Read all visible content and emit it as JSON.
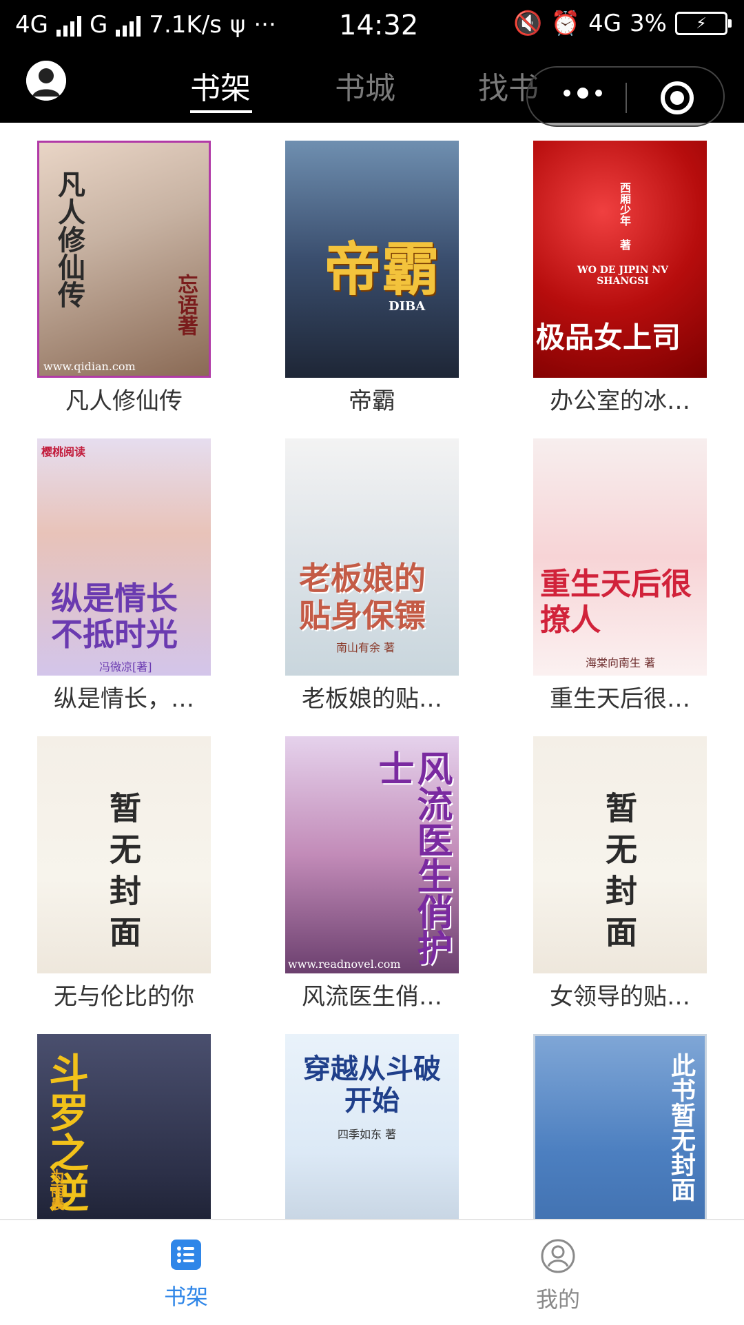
{
  "status_bar": {
    "network1": "4G",
    "network2": "G",
    "speed": "7.1K/s",
    "more": "···",
    "time": "14:32",
    "network3": "4G",
    "battery": "3%"
  },
  "header": {
    "tabs": [
      "书架",
      "书城",
      "找书"
    ],
    "active_tab": "书架"
  },
  "books": [
    {
      "title": "凡人修仙传",
      "cover_text": "凡人修仙传",
      "cover_sub": "忘语著",
      "cover_footer": "www.qidian.com"
    },
    {
      "title": "帝霸",
      "cover_text": "帝霸",
      "cover_sub": "DIBA"
    },
    {
      "title": "办公室的冰…",
      "cover_text": "极品女上司",
      "cover_sub": "WO DE JIPIN NV SHANGSI",
      "cover_author": "西厢少年 著"
    },
    {
      "title": "纵是情长，…",
      "cover_text": "纵是情长不抵时光",
      "cover_sub": "冯微凉[著]",
      "cover_brand": "樱桃阅读"
    },
    {
      "title": "老板娘的贴…",
      "cover_text": "老板娘的贴身保镖",
      "cover_sub": "南山有余 著"
    },
    {
      "title": "重生天后很…",
      "cover_text": "重生天后很撩人",
      "cover_sub": "海棠向南生 著"
    },
    {
      "title": "无与伦比的你",
      "cover_text": "暂无封面"
    },
    {
      "title": "风流医生俏…",
      "cover_text": "风流医生俏护士",
      "cover_footer": "www.readnovel.com"
    },
    {
      "title": "女领导的贴…",
      "cover_text": "暂无封面"
    },
    {
      "title": "",
      "cover_text": "斗罗之逆",
      "cover_sub": "为雨晨 著"
    },
    {
      "title": "",
      "cover_text": "穿越从斗破开始",
      "cover_sub": "四季如东 著"
    },
    {
      "title": "",
      "cover_text": "此书暂无封面"
    }
  ],
  "bottom_nav": [
    {
      "label": "书架",
      "icon": "list-icon",
      "active": true
    },
    {
      "label": "我的",
      "icon": "user-icon",
      "active": false
    }
  ],
  "colors": {
    "accent": "#2f86e8",
    "header_bg": "#000000"
  }
}
